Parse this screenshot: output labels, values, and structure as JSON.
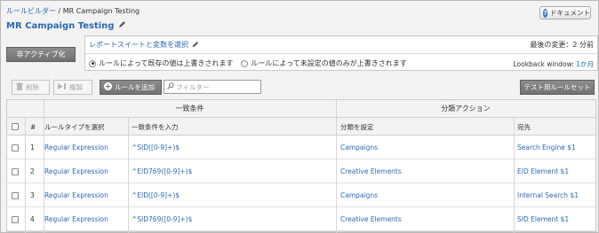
{
  "breadcrumb": {
    "root": "ルールビルダー",
    "separator": " / ",
    "current": "MR Campaign Testing"
  },
  "page_title": "MR Campaign Testing",
  "doc_button": {
    "label": "ドキュメント"
  },
  "inactive_button": {
    "label": "非アクティブ化"
  },
  "settings": {
    "report_suite_link": "レポートスイートと変数を選択",
    "last_modified": "最後の変更：2 分前",
    "radio_overwrite": "ルールによって既存の値は上書きされます",
    "radio_unset_only": "ルールによって未設定の値のみが上書きされます",
    "selected_radio": "overwrite",
    "lookback_label": "Lookback window: ",
    "lookback_value": "1か月"
  },
  "toolbar": {
    "delete_label": "削除",
    "copy_label": "複製",
    "add_rule_label": "ルールを追加",
    "filter_placeholder": "フィルター",
    "test_ruleset_label": "テスト用ルールセット"
  },
  "table": {
    "group_headers": {
      "match": "一致条件",
      "classify": "分類アクション"
    },
    "columns": {
      "num": "#",
      "rule_type": "ルールタイプを選択",
      "match_condition": "一致条件を入力",
      "set_classification": "分類を設定",
      "to": "宛先"
    },
    "rows": [
      {
        "num": "1",
        "rule_type": "Regular Expression",
        "match": "^SID([0-9]+)$",
        "classification": "Campaigns",
        "to": "Search Engine $1"
      },
      {
        "num": "2",
        "rule_type": "Regular Expression",
        "match": "^EID769([0-9]+)$",
        "classification": "Creative Elements",
        "to": "EID Element $1"
      },
      {
        "num": "3",
        "rule_type": "Regular Expression",
        "match": "^EID([0-9]+)$",
        "classification": "Campaigns",
        "to": "Internal Search $1"
      },
      {
        "num": "4",
        "rule_type": "Regular Expression",
        "match": "^SID769([0-9]+)$",
        "classification": "Creative Elements",
        "to": "SID Element $1"
      }
    ]
  },
  "colors": {
    "link": "#2a69b4",
    "dark_button": "#7d7d7d",
    "help_icon": "#2f73c0"
  }
}
